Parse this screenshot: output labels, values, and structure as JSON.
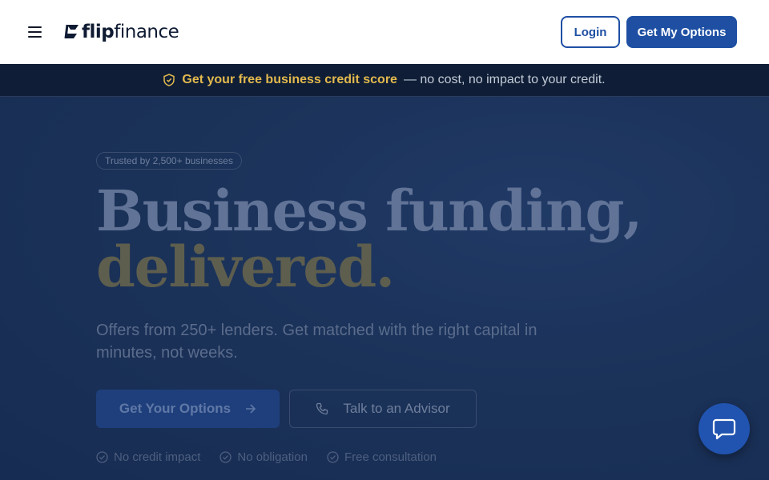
{
  "header": {
    "logo_text_bold": "flip",
    "logo_text_light": "finance",
    "login_label": "Login",
    "options_label": "Get My Options"
  },
  "promo": {
    "strong": "Get your free business credit score",
    "rest": "— no cost, no impact to your credit."
  },
  "hero": {
    "badge": "Trusted by 2,500+ businesses",
    "headline_line1": "Business funding,",
    "headline_line2": "delivered.",
    "subheadline": "Offers from 250+ lenders. Get matched with the right capital in minutes, not weeks.",
    "primary_cta": "Get Your Options",
    "secondary_cta": "Talk to an Advisor",
    "assurances": [
      "No credit impact",
      "No obligation",
      "Free consultation"
    ]
  },
  "colors": {
    "brand": "#1e4fa3",
    "promo_accent": "#e3b94e",
    "hero_bg": "#1b3259"
  },
  "icons": {
    "menu": "hamburger-icon",
    "promo": "shield-check-icon",
    "primary_cta": "arrow-right-icon",
    "secondary_cta": "phone-icon",
    "assurance": "check-circle-icon",
    "chat": "chat-bubble-icon"
  }
}
